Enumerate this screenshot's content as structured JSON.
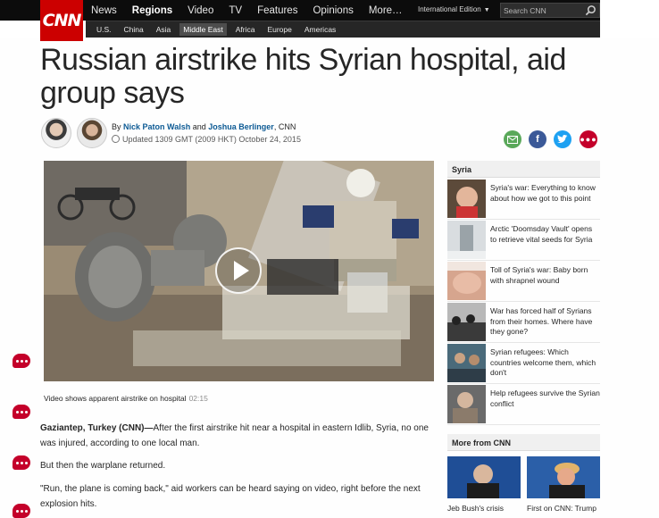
{
  "header": {
    "logo": "CNN",
    "nav": [
      "News",
      "Regions",
      "Video",
      "TV",
      "Features",
      "Opinions",
      "More…"
    ],
    "active_nav": "Regions",
    "edition": "International Edition",
    "search_placeholder": "Search CNN",
    "subnav": [
      "U.S.",
      "China",
      "Asia",
      "Middle East",
      "Africa",
      "Europe",
      "Americas"
    ],
    "active_subnav": "Middle East"
  },
  "article": {
    "headline": "Russian airstrike hits Syrian hospital, aid group says",
    "byline_prefix": "By",
    "author1": "Nick Paton Walsh",
    "and": "and",
    "author2": "Joshua Berlinger",
    "outlet": ", CNN",
    "updated": "Updated 1309 GMT (2009 HKT) October 24, 2015",
    "video_caption": "Video shows apparent airstrike on hospital",
    "video_duration": "02:15",
    "dateline": "Gaziantep, Turkey (CNN)—",
    "p1": "After the first airstrike hit near a hospital in eastern Idlib, Syria, no one was injured, according to one local man.",
    "p2": "But then the warplane returned.",
    "p3": "\"Run, the plane is coming back,\" aid workers can be heard saying on video, right before the next explosion hits."
  },
  "sidebar": {
    "title": "Syria",
    "items": [
      {
        "text": "Syria's war: Everything to know about how we got to this point"
      },
      {
        "text": "Arctic 'Doomsday Vault' opens to retrieve vital seeds for Syria"
      },
      {
        "text": "Toll of Syria's war: Baby born with shrapnel wound"
      },
      {
        "text": "War has forced half of Syrians from their homes. Where have they gone?"
      },
      {
        "text": "Syrian refugees: Which countries welcome them, which don't"
      },
      {
        "text": "Help refugees survive the Syrian conflict"
      }
    ],
    "more_title": "More from CNN",
    "more": [
      {
        "caption": "Jeb Bush's crisis"
      },
      {
        "caption": "First on CNN: Trump"
      }
    ]
  },
  "colors": {
    "brand": "#cc0000",
    "link": "#0c5a94",
    "comment": "#c4002a"
  }
}
